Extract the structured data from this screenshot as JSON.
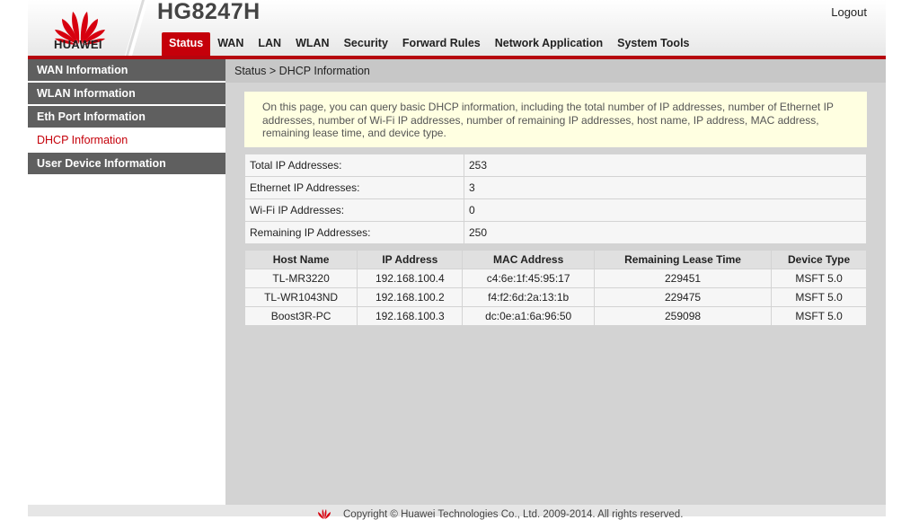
{
  "header": {
    "brand": "HUAWEI",
    "model": "HG8247H",
    "logout_label": "Logout"
  },
  "nav": {
    "items": [
      "Status",
      "WAN",
      "LAN",
      "WLAN",
      "Security",
      "Forward Rules",
      "Network Application",
      "System Tools"
    ],
    "active": "Status"
  },
  "sidebar": {
    "items": [
      "WAN Information",
      "WLAN Information",
      "Eth Port Information",
      "DHCP Information",
      "User Device Information"
    ],
    "active": "DHCP Information"
  },
  "breadcrumb": "Status > DHCP Information",
  "notice": "On this page, you can query basic DHCP information, including the total number of IP addresses, number of Ethernet IP addresses, number of Wi-Fi IP addresses, number of remaining IP addresses, host name, IP address, MAC address, remaining lease time, and device type.",
  "summary": [
    {
      "label": "Total IP Addresses:",
      "value": "253"
    },
    {
      "label": "Ethernet IP Addresses:",
      "value": "3"
    },
    {
      "label": "Wi-Fi IP Addresses:",
      "value": "0"
    },
    {
      "label": "Remaining IP Addresses:",
      "value": "250"
    }
  ],
  "devices": {
    "columns": [
      "Host Name",
      "IP Address",
      "MAC Address",
      "Remaining Lease Time",
      "Device Type"
    ],
    "rows": [
      [
        "TL-MR3220",
        "192.168.100.4",
        "c4:6e:1f:45:95:17",
        "229451",
        "MSFT 5.0"
      ],
      [
        "TL-WR1043ND",
        "192.168.100.2",
        "f4:f2:6d:2a:13:1b",
        "229475",
        "MSFT 5.0"
      ],
      [
        "Boost3R-PC",
        "192.168.100.3",
        "dc:0e:a1:6a:96:50",
        "259098",
        "MSFT 5.0"
      ]
    ]
  },
  "footer": {
    "copyright": "Copyright © Huawei Technologies Co., Ltd. 2009-2014. All rights reserved."
  },
  "colors": {
    "brand_red": "#c5000a",
    "sidebar_bg": "#5f5f5f",
    "notice_bg": "#ffffe1"
  },
  "icons": [
    "huawei-logo",
    "huawei-footer-logo"
  ]
}
